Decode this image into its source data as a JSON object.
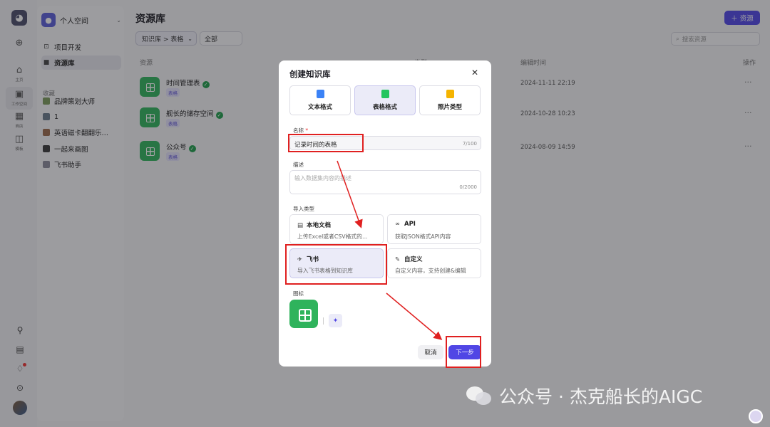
{
  "rail": {
    "items": [
      {
        "glyph": "⊕",
        "label": ""
      },
      {
        "glyph": "⌂",
        "label": "主页"
      },
      {
        "glyph": "▣",
        "label": "工作空间"
      },
      {
        "glyph": "▦",
        "label": "商店"
      },
      {
        "glyph": "◫",
        "label": "模板"
      }
    ]
  },
  "sidebar": {
    "workspace": "个人空间",
    "items": [
      {
        "label": "项目开发",
        "icon": "robot-icon"
      },
      {
        "label": "资源库",
        "icon": "library-icon"
      }
    ],
    "favorites_label": "收藏",
    "favorites": [
      {
        "label": "品牌策划大师",
        "color": "#7a9a5a"
      },
      {
        "label": "1",
        "color": "#6a7a8a"
      },
      {
        "label": "英语磁卡翻翻乐…",
        "color": "#9a6a4a"
      },
      {
        "label": "一起来画图",
        "color": "#3a3a3a"
      },
      {
        "label": "飞书助手",
        "color": "#8a8a9a"
      }
    ]
  },
  "main": {
    "title": "资源库",
    "add_button": "＋ 资源",
    "filter_type": "知识库 > 表格",
    "filter_all": "全部",
    "search_placeholder": "搜索资源",
    "columns": {
      "resource": "资源",
      "type": "类型",
      "edited": "编辑时间",
      "actions": "操作"
    },
    "rows": [
      {
        "name": "时间管理表",
        "tag": "表格",
        "time": "2024-11-11 22:19"
      },
      {
        "name": "舰长的储存空间",
        "tag": "表格",
        "time": "2024-10-28 10:23"
      },
      {
        "name": "公众号",
        "tag": "表格",
        "time": "2024-08-09 14:59"
      }
    ]
  },
  "modal": {
    "title": "创建知识库",
    "formats": [
      {
        "label": "文本格式",
        "color": "#3b82f6"
      },
      {
        "label": "表格格式",
        "color": "#22c55e"
      },
      {
        "label": "照片类型",
        "color": "#f5b400"
      }
    ],
    "name_label": "名称",
    "name_required": "*",
    "name_value": "记录时间的表格",
    "name_count": "7/100",
    "desc_label": "描述",
    "desc_placeholder": "输入数据集内容的描述",
    "desc_count": "0/2000",
    "import_label": "导入类型",
    "imports": [
      {
        "title": "本地文档",
        "desc": "上传Excel或者CSV格式的…",
        "glyph": "▤"
      },
      {
        "title": "API",
        "desc": "获取JSON格式API内容",
        "glyph": "∞"
      },
      {
        "title": "飞书",
        "desc": "导入飞书表格到知识库",
        "glyph": "✈"
      },
      {
        "title": "自定义",
        "desc": "自定义内容，支持创建&编辑",
        "glyph": "✎"
      }
    ],
    "icon_label": "图标",
    "cancel": "取消",
    "next": "下一步"
  },
  "watermark": "公众号 · 杰克船长的AIGC",
  "colors": {
    "accent": "#5046e5",
    "sheet_green": "#2fb35c",
    "highlight": "#e02020"
  }
}
